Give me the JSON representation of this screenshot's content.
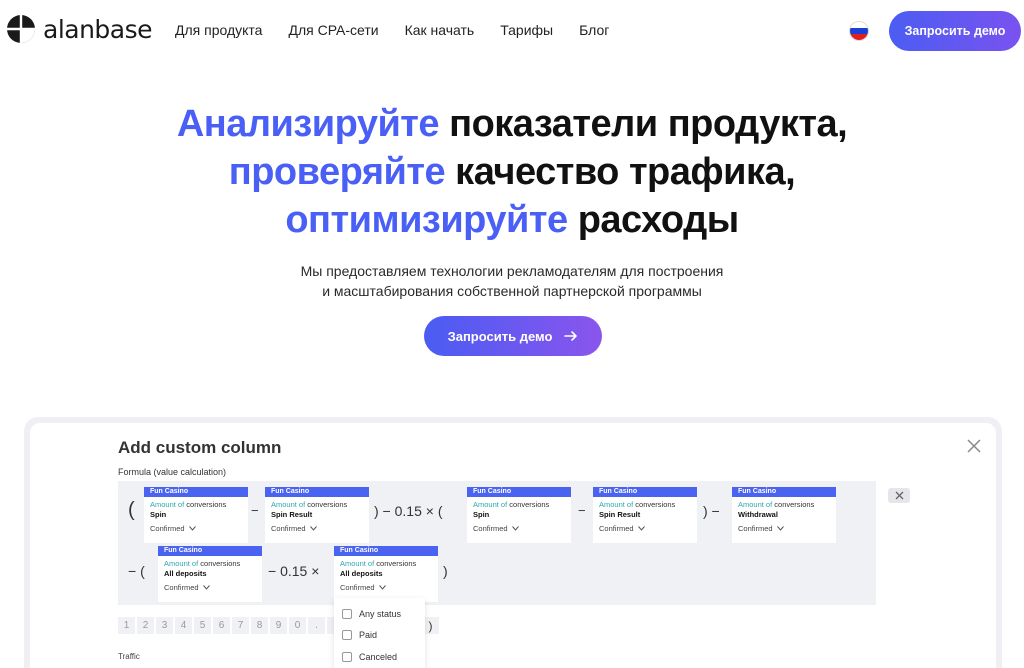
{
  "header": {
    "logo_text": "alanbase",
    "nav": [
      "Для продукта",
      "Для CPA-сети",
      "Как начать",
      "Тарифы",
      "Блог"
    ],
    "demo_button": "Запросить демо",
    "flag_colors": [
      "#ffffff",
      "#1c3fd8",
      "#e02020"
    ]
  },
  "hero": {
    "line1_highlight": "Анализируйте",
    "line1_rest": "показатели продукта,",
    "line2_highlight": "проверяйте",
    "line2_rest": "качество трафика,",
    "line3_highlight": "оптимизируйте",
    "line3_rest": "расходы",
    "subtitle_line1": "Мы предоставляем технологии рекламодателям для построения",
    "subtitle_line2": "и масштабирования собственной партнерской программы",
    "cta": "Запросить демо",
    "accent_color": "#4a5ff5"
  },
  "panel": {
    "title": "Add custom column",
    "formula_label": "Formula (value calculation)",
    "cards": [
      {
        "head": "Fun Casino",
        "metric_accent": "Amount of",
        "metric_rest": "conversions",
        "event": "Spin",
        "status": "Confirmed"
      },
      {
        "head": "Fun Casino",
        "metric_accent": "Amount of",
        "metric_rest": "conversions",
        "event": "Spin Result",
        "status": "Confirmed"
      },
      {
        "head": "Fun Casino",
        "metric_accent": "Amount of",
        "metric_rest": "conversions",
        "event": "Spin",
        "status": "Confirmed"
      },
      {
        "head": "Fun Casino",
        "metric_accent": "Amount of",
        "metric_rest": "conversions",
        "event": "Spin Result",
        "status": "Confirmed"
      },
      {
        "head": "Fun Casino",
        "metric_accent": "Amount of",
        "metric_rest": "conversions",
        "event": "Withdrawal",
        "status": "Confirmed"
      },
      {
        "head": "Fun Casino",
        "metric_accent": "Amount of",
        "metric_rest": "conversions",
        "event": "All deposits",
        "status": "Confirmed"
      },
      {
        "head": "Fun Casino",
        "metric_accent": "Amount of",
        "metric_rest": "conversions",
        "event": "All deposits",
        "status": "Confirmed"
      }
    ],
    "operators": {
      "open_paren": "(",
      "close_paren": ")",
      "minus": "−",
      "minus_coef_times": "− 0.15 ×",
      "close_minus_coef_times_open": ") − 0.15 × (",
      "close_minus": ") −",
      "minus_open": "− (",
      "close_final": ")"
    },
    "keys": [
      "1",
      "2",
      "3",
      "4",
      "5",
      "6",
      "7",
      "8",
      "9",
      "0",
      ".",
      "",
      "",
      "",
      "",
      "(",
      ")"
    ],
    "traffic_label": "Traffic",
    "dropdown": [
      "Any status",
      "Paid",
      "Canceled"
    ]
  }
}
